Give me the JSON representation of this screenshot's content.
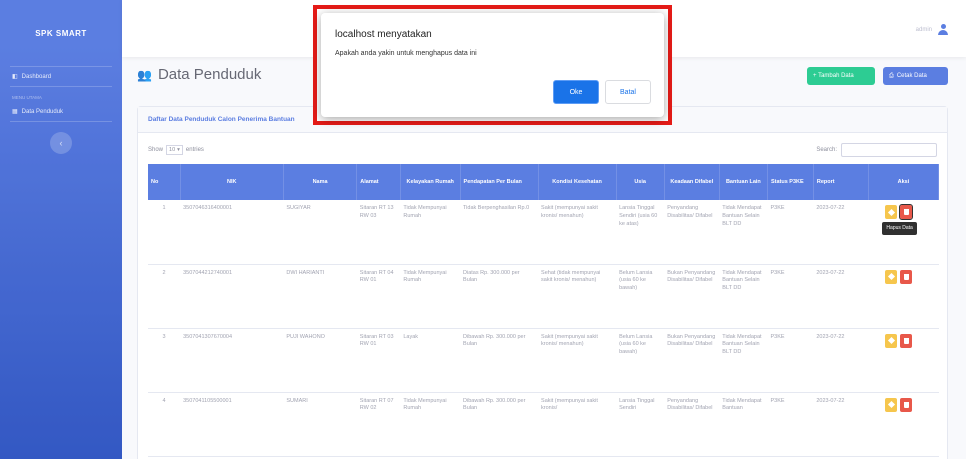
{
  "sidebar": {
    "brand": "SPK SMART",
    "items": [
      {
        "label": "Dashboard"
      },
      {
        "label": "Data Penduduk"
      }
    ],
    "heading": "MENU UTAMA"
  },
  "topbar": {
    "username": "admin"
  },
  "page": {
    "title": "Data Penduduk",
    "add_button": "+ Tambah Data",
    "print_button": "Cetak Data"
  },
  "card": {
    "header": "Daftar Data Penduduk Calon Penerima Bantuan",
    "show_label": "Show",
    "show_value": "10",
    "entries_label": "entries",
    "search_label": "Search:"
  },
  "table": {
    "headers": [
      "No",
      "NIK",
      "Nama",
      "Alamat",
      "Kelayakan Rumah",
      "Pendapatan Per Bulan",
      "Kondisi Kesehatan",
      "Usia",
      "Keadaan Difabel",
      "Bantuan Lain",
      "Status P3KE",
      "Report",
      "Aksi"
    ],
    "rows": [
      [
        "1",
        "3507046316400001",
        "SUGIYAR",
        "Sitaran RT 13 RW 03",
        "Tidak Mempunyai Rumah",
        "Tidak Berpenghasilan Rp.0",
        "Sakit (mempunyai sakit kronis/ menahun)",
        "Lansia Tinggal Sendiri (usia 60 ke atas)",
        "Penyandang Disabilitas/ Difabel",
        "Tidak Mendapat Bantuan Selain BLT DD",
        "P3KE",
        "2023-07-22"
      ],
      [
        "2",
        "3507044212740001",
        "DWI HARIANTI",
        "Sitaran RT 04 RW 01",
        "Tidak Mempunyai Rumah",
        "Diatas Rp. 300.000 per Bulan",
        "Sehat (tidak mempunyai sakit kronis/ menahun)",
        "Belum Lansia (usia 60 ke bawah)",
        "Bukan Penyandang Disabilitas/ Difabel",
        "Tidak Mendapat Bantuan Selain BLT DD",
        "P3KE",
        "2023-07-22"
      ],
      [
        "3",
        "3507041307670004",
        "PUJI WAHONO",
        "Sitaran RT 03 RW 01",
        "Layak",
        "Dibawah Rp. 300.000 per Bulan",
        "Sakit (mempunyai sakit kronis/ menahun)",
        "Belum Lansia (usia 60 ke bawah)",
        "Bukan Penyandang Disabilitas/ Difabel",
        "Tidak Mendapat Bantuan Selain BLT DD",
        "P3KE",
        "2023-07-22"
      ],
      [
        "4",
        "3507041105500001",
        "SUMARI",
        "Sitaran RT 07 RW 02",
        "Tidak Mempunyai Rumah",
        "Dibawah Rp. 300.000 per Bulan",
        "Sakit (mempunyai sakit kronis/",
        "Lansia Tinggal Sendiri",
        "Penyandang Disabilitas/ Difabel",
        "Tidak Mendapat Bantuan",
        "P3KE",
        "2023-07-22"
      ]
    ],
    "tooltip": "Hapus Data"
  },
  "dialog": {
    "title": "localhost menyatakan",
    "message": "Apakah anda yakin untuk menghapus data ini",
    "ok_label": "Oke",
    "cancel_label": "Batal"
  },
  "colors": {
    "primary": "#4e73df",
    "success": "#1cc88a",
    "warning": "#f6c23e",
    "danger": "#e74a3b",
    "highlight_border": "#e51b17"
  }
}
